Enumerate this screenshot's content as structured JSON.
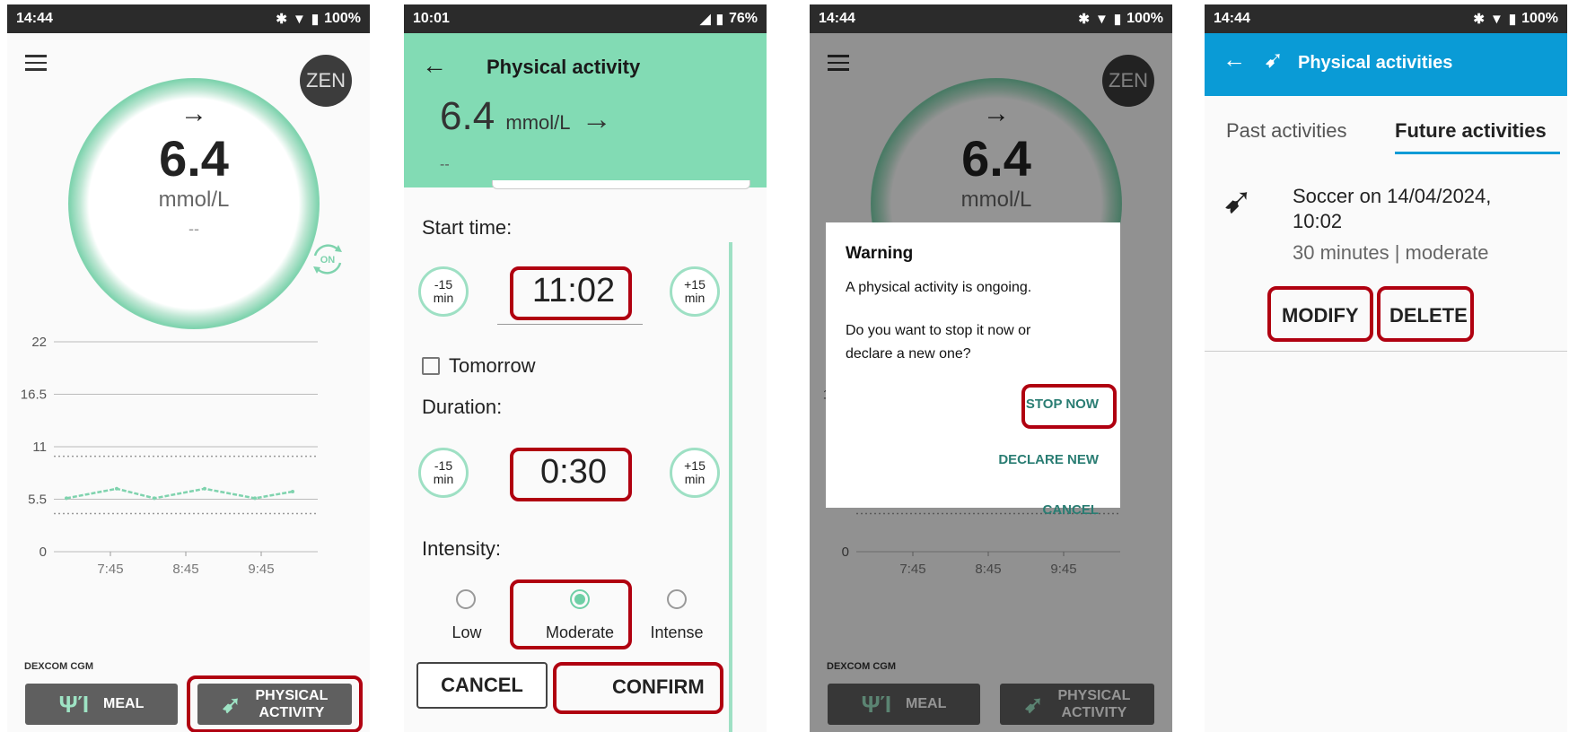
{
  "screen1": {
    "status": {
      "time": "14:44",
      "battery": "100%"
    },
    "avatar": "ZEN",
    "glucose": {
      "arrow": "→",
      "value": "6.4",
      "unit": "mmol/L",
      "trend": "--"
    },
    "chart_data": {
      "type": "line",
      "y_ticks": [
        "22",
        "16.5",
        "11",
        "5.5",
        "0"
      ],
      "x_ticks": [
        "7:45",
        "8:45",
        "9:45"
      ],
      "ylim": [
        0,
        22
      ],
      "target_range": [
        4,
        10
      ],
      "points": [
        {
          "x": "7:10",
          "y": 5.6
        },
        {
          "x": "7:50",
          "y": 6.6
        },
        {
          "x": "8:20",
          "y": 5.6
        },
        {
          "x": "9:00",
          "y": 6.6
        },
        {
          "x": "9:40",
          "y": 5.6
        },
        {
          "x": "10:10",
          "y": 6.3
        }
      ],
      "line_color": "#7fd3ae"
    },
    "source_label": "DEXCOM CGM",
    "buttons": {
      "meal": "MEAL",
      "physical_line1": "PHYSICAL",
      "physical_line2": "ACTIVITY"
    }
  },
  "screen2": {
    "status": {
      "time": "10:01",
      "battery": "76%"
    },
    "title": "Physical activity",
    "glucose": {
      "value": "6.4",
      "unit": "mmol/L",
      "arrow": "→",
      "trend": "--"
    },
    "start_label": "Start time:",
    "minus": {
      "line1": "-15",
      "line2": "min"
    },
    "plus": {
      "line1": "+15",
      "line2": "min"
    },
    "start_time": "11:02",
    "tomorrow": "Tomorrow",
    "duration_label": "Duration:",
    "duration": "0:30",
    "intensity_label": "Intensity:",
    "intensity": {
      "low": "Low",
      "moderate": "Moderate",
      "intense": "Intense",
      "selected": "Moderate"
    },
    "cancel": "CANCEL",
    "confirm": "CONFIRM",
    "accent": "#82dbb4"
  },
  "screen3": {
    "status": {
      "time": "14:44",
      "battery": "100%"
    },
    "dialog": {
      "title": "Warning",
      "line1": "A physical activity is ongoing.",
      "line2": "Do you want to stop it now or",
      "line3": "declare a new one?",
      "stop": "STOP NOW",
      "declare": "DECLARE NEW",
      "cancel": "CANCEL"
    }
  },
  "screen4": {
    "status": {
      "time": "14:44",
      "battery": "100%"
    },
    "title": "Physical activities",
    "tabs": {
      "past": "Past activities",
      "future": "Future activities"
    },
    "activity": {
      "line1": "Soccer on 14/04/2024,",
      "line2": "10:02",
      "details": "30 minutes | moderate"
    },
    "modify": "MODIFY",
    "delete": "DELETE",
    "accent": "#0a9bd6"
  }
}
